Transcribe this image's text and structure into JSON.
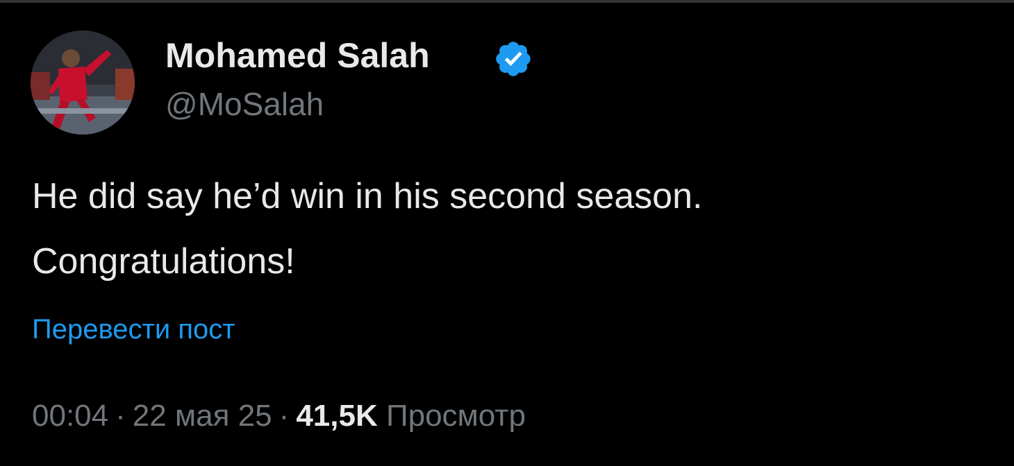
{
  "colors": {
    "background": "#000000",
    "primary_text": "#e7e9ea",
    "secondary_text": "#71767b",
    "link": "#1d9bf0",
    "verified_badge": "#1d9bf0"
  },
  "author": {
    "avatar_icon": "profile-photo",
    "display_name": "Mohamed Salah",
    "verified_icon": "verified-badge-icon",
    "handle": "@MoSalah"
  },
  "post": {
    "text_lines": [
      "He did say he’d win in his second season.",
      "Congratulations!"
    ],
    "translate_label": "Перевести пост"
  },
  "meta": {
    "time": "00:04",
    "separator": "·",
    "date": "22 мая 25",
    "views_count": "41,5K",
    "views_label": "Просмотр"
  }
}
